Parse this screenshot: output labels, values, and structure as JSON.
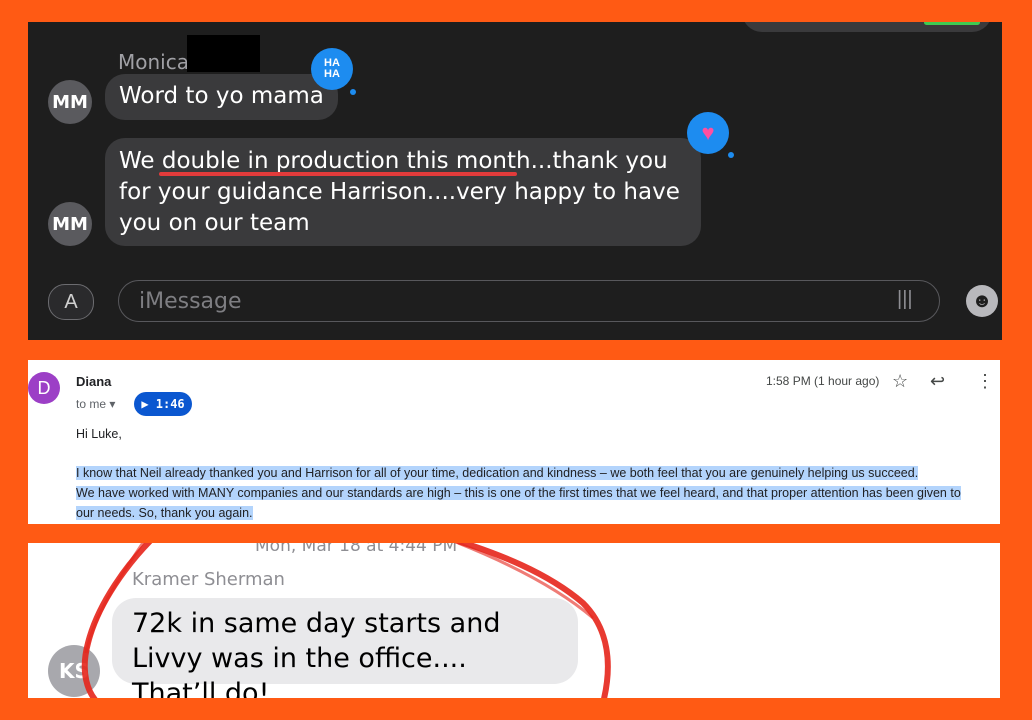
{
  "imessage_dark": {
    "sender": "Monica",
    "avatar_initials": "MM",
    "messages": [
      {
        "text": "Word to yo mama"
      },
      {
        "text": "We double in production this month...thank you for your guidance Harrison....very happy to have you on our team"
      }
    ],
    "tapbacks": {
      "haha_line1": "HA",
      "haha_line2": "HA",
      "heart": "♥"
    },
    "input_placeholder": "iMessage",
    "icons": {
      "app_store": "A",
      "waveform": "|||",
      "emoji": "☻"
    }
  },
  "email": {
    "avatar_letter": "D",
    "sender": "Diana",
    "to": "to me ▾",
    "voice_clip": "▶ 1:46",
    "time": "1:58 PM (1 hour ago)",
    "icons": {
      "star": "☆",
      "reply": "↩",
      "more": "⋮"
    },
    "greeting": "Hi Luke,",
    "body_lines": [
      "I know that Neil already thanked you and Harrison for all of your time, dedication and kindness – we both feel that you are genuinely helping us succeed.",
      "We have worked with MANY companies and our standards are high – this is one of the first times that we feel heard, and that proper attention has been given to",
      "our needs. So, thank you again."
    ]
  },
  "imessage_light": {
    "date_header": "Mon, Mar 18 at 4:44 PM",
    "sender": "Kramer Sherman",
    "avatar_initials": "KS",
    "message": "72k in same day starts and Livvy was in the office.... That’ll do!"
  },
  "colors": {
    "background": "#FF5A14",
    "dark_panel": "#1E1E1E",
    "dark_bubble": "#3A3A3C",
    "tapback_blue": "#1D8CF0",
    "underline_red": "#E23B3B",
    "highlight_blue": "#B3D4FC",
    "gmail_avatar": "#9C3FC6",
    "light_bubble": "#E9E9EB",
    "scribble_red": "#E5251B"
  }
}
